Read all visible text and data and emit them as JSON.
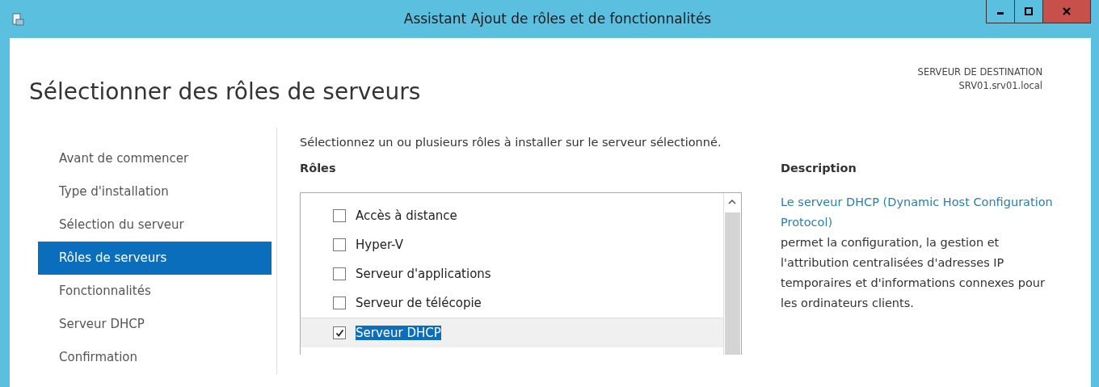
{
  "window": {
    "title": "Assistant Ajout de rôles et de fonctionnalités"
  },
  "page_title": "Sélectionner des rôles de serveurs",
  "destination": {
    "label": "SERVEUR DE DESTINATION",
    "server": "SRV01.srv01.local"
  },
  "steps": [
    {
      "label": "Avant de commencer",
      "selected": false
    },
    {
      "label": "Type d'installation",
      "selected": false
    },
    {
      "label": "Sélection du serveur",
      "selected": false
    },
    {
      "label": "Rôles de serveurs",
      "selected": true
    },
    {
      "label": "Fonctionnalités",
      "selected": false
    },
    {
      "label": "Serveur DHCP",
      "selected": false
    },
    {
      "label": "Confirmation",
      "selected": false
    }
  ],
  "instruction": "Sélectionnez un ou plusieurs rôles à installer sur le serveur sélectionné.",
  "roles": {
    "heading": "Rôles",
    "items": [
      {
        "label": "Accès à distance",
        "checked": false,
        "selected": false
      },
      {
        "label": "Hyper-V",
        "checked": false,
        "selected": false
      },
      {
        "label": "Serveur d'applications",
        "checked": false,
        "selected": false
      },
      {
        "label": "Serveur de télécopie",
        "checked": false,
        "selected": false
      },
      {
        "label": "Serveur DHCP",
        "checked": true,
        "selected": true
      }
    ]
  },
  "description": {
    "heading": "Description",
    "link": "Le serveur DHCP (Dynamic Host Configuration Protocol)",
    "text": " permet la configuration, la gestion et l'attribution centralisées d'adresses IP temporaires et d'informations connexes pour les ordinateurs clients."
  }
}
